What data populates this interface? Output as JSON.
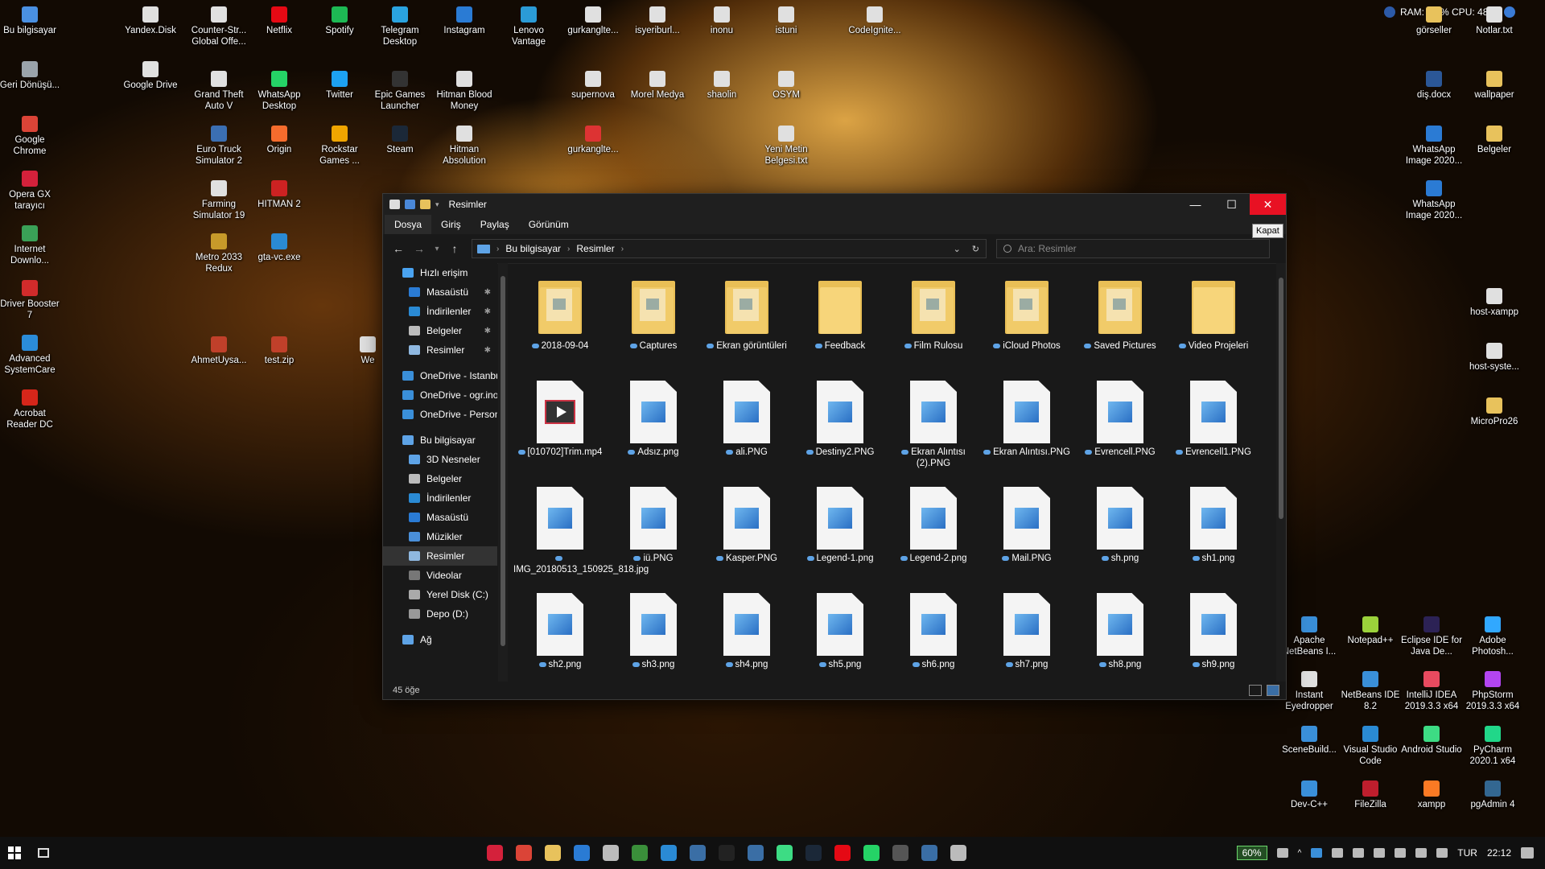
{
  "desktop": {
    "icons": [
      {
        "label": "Bu bilgisayar",
        "color": "#4a90e2"
      },
      {
        "label": "Geri Dönüşü...",
        "color": "#9aa3ab"
      },
      {
        "label": "Google Chrome",
        "color": "#db4437"
      },
      {
        "label": "Opera GX tarayıcı",
        "color": "#d4213b"
      },
      {
        "label": "Internet Downlo...",
        "color": "#3aa157"
      },
      {
        "label": "Driver Booster 7",
        "color": "#d12b2b"
      },
      {
        "label": "Advanced SystemCare",
        "color": "#2b8cd9"
      },
      {
        "label": "Acrobat Reader DC",
        "color": "#d6261a"
      },
      {
        "label": "Yandex.Disk",
        "color": "#e0e0e0"
      },
      {
        "label": "Google Drive",
        "color": "#e0e0e0"
      },
      {
        "label": "Counter-Str... Global Offe...",
        "color": "#e0e0e0"
      },
      {
        "label": "Grand Theft Auto V",
        "color": "#e0e0e0"
      },
      {
        "label": "Euro Truck Simulator 2",
        "color": "#3b6fb3"
      },
      {
        "label": "Farming Simulator 19",
        "color": "#e0e0e0"
      },
      {
        "label": "Metro 2033 Redux",
        "color": "#c79a2a"
      },
      {
        "label": "AhmetUysa...",
        "color": "#c0402a"
      },
      {
        "label": "Netflix",
        "color": "#e50914"
      },
      {
        "label": "WhatsApp Desktop",
        "color": "#25d366"
      },
      {
        "label": "Origin",
        "color": "#f56c2d"
      },
      {
        "label": "HITMAN 2",
        "color": "#c22"
      },
      {
        "label": "gta-vc.exe",
        "color": "#2a8ad4"
      },
      {
        "label": "test.zip",
        "color": "#c0402a"
      },
      {
        "label": "Spotify",
        "color": "#1db954"
      },
      {
        "label": "Twitter",
        "color": "#1da1f2"
      },
      {
        "label": "Rockstar Games ...",
        "color": "#f0a500"
      },
      {
        "label": "Telegram Desktop",
        "color": "#2aa3df"
      },
      {
        "label": "Epic Games Launcher",
        "color": "#333"
      },
      {
        "label": "Steam",
        "color": "#1b2838"
      },
      {
        "label": "Instagram",
        "color": "#2a7bd4"
      },
      {
        "label": "Hitman Blood Money",
        "color": "#e0e0e0"
      },
      {
        "label": "Hitman Absolution",
        "color": "#e0e0e0"
      },
      {
        "label": "Lenovo Vantage",
        "color": "#2b9bd6"
      },
      {
        "label": "gurkanglte...",
        "color": "#e0e0e0"
      },
      {
        "label": "supernova",
        "color": "#e0e0e0"
      },
      {
        "label": "gurkanglte...",
        "color": "#d33"
      },
      {
        "label": "isyeriburl...",
        "color": "#e0e0e0"
      },
      {
        "label": "Morel Medya",
        "color": "#e0e0e0"
      },
      {
        "label": "inonu",
        "color": "#e0e0e0"
      },
      {
        "label": "shaolin",
        "color": "#e0e0e0"
      },
      {
        "label": "istuni",
        "color": "#e0e0e0"
      },
      {
        "label": "OSYM",
        "color": "#e0e0e0"
      },
      {
        "label": "Yeni Metin Belgesi.txt",
        "color": "#e0e0e0"
      },
      {
        "label": "CodeIgnite...",
        "color": "#e0e0e0"
      },
      {
        "label": "görseller",
        "color": "#e8c25c"
      },
      {
        "label": "diş.docx",
        "color": "#2b5797"
      },
      {
        "label": "WhatsApp Image 2020...",
        "color": "#2b7bd4"
      },
      {
        "label": "WhatsApp Image 2020...",
        "color": "#2b7bd4"
      },
      {
        "label": "Notlar.txt",
        "color": "#e0e0e0"
      },
      {
        "label": "wallpaper",
        "color": "#e8c25c"
      },
      {
        "label": "Belgeler",
        "color": "#e8c25c"
      },
      {
        "label": "host-xampp",
        "color": "#e0e0e0"
      },
      {
        "label": "host-syste...",
        "color": "#e0e0e0"
      },
      {
        "label": "MicroPro26",
        "color": "#e8c25c"
      },
      {
        "label": "Apache NetBeans I...",
        "color": "#3a8fd9"
      },
      {
        "label": "Instant Eyedropper",
        "color": "#e0e0e0"
      },
      {
        "label": "SceneBuild...",
        "color": "#3a8fd9"
      },
      {
        "label": "Dev-C++",
        "color": "#3a8fd9"
      },
      {
        "label": "Notepad++",
        "color": "#9bd13b"
      },
      {
        "label": "NetBeans IDE 8.2",
        "color": "#3a8fd9"
      },
      {
        "label": "Visual Studio Code",
        "color": "#2a8ad4"
      },
      {
        "label": "FileZilla",
        "color": "#bf1e2d"
      },
      {
        "label": "Eclipse IDE for Java De...",
        "color": "#2c2255"
      },
      {
        "label": "IntelliJ IDEA 2019.3.3 x64",
        "color": "#e84a5f"
      },
      {
        "label": "Android Studio",
        "color": "#3ddc84"
      },
      {
        "label": "xampp",
        "color": "#fb7a24"
      },
      {
        "label": "Adobe Photosh...",
        "color": "#31a8ff"
      },
      {
        "label": "PhpStorm 2019.3.3 x64",
        "color": "#b345f1"
      },
      {
        "label": "PyCharm 2020.1 x64",
        "color": "#21d789"
      },
      {
        "label": "pgAdmin 4",
        "color": "#336791"
      },
      {
        "label": "We",
        "color": "#e0e0e0"
      }
    ]
  },
  "sysmon": {
    "text": "RAM: 78 %  CPU: 48 %"
  },
  "window": {
    "title": "Resimler",
    "close_tooltip": "Kapat",
    "ribbon_tabs": [
      "Dosya",
      "Giriş",
      "Paylaş",
      "Görünüm"
    ],
    "breadcrumb": [
      "Bu bilgisayar",
      "Resimler"
    ],
    "search_placeholder": "Ara: Resimler",
    "nav": [
      {
        "label": "Hızlı erişim",
        "color": "#4aa3f0",
        "pinned": false
      },
      {
        "label": "Masaüstü",
        "color": "#2a7bd4",
        "pinned": true
      },
      {
        "label": "İndirilenler",
        "color": "#2a8ad4",
        "pinned": true
      },
      {
        "label": "Belgeler",
        "color": "#bbb",
        "pinned": true
      },
      {
        "label": "Resimler",
        "color": "#8fb8e0",
        "pinned": true
      },
      {
        "label": "OneDrive - Istanbul",
        "color": "#3a8fd9",
        "pinned": false
      },
      {
        "label": "OneDrive - ogr.inonu",
        "color": "#3a8fd9",
        "pinned": false
      },
      {
        "label": "OneDrive - Personal",
        "color": "#3a8fd9",
        "pinned": false
      },
      {
        "label": "Bu bilgisayar",
        "color": "#5ea3e6",
        "pinned": false
      },
      {
        "label": "3D Nesneler",
        "color": "#5ea3e6",
        "pinned": false
      },
      {
        "label": "Belgeler",
        "color": "#bbb",
        "pinned": false
      },
      {
        "label": "İndirilenler",
        "color": "#2a8ad4",
        "pinned": false
      },
      {
        "label": "Masaüstü",
        "color": "#2a7bd4",
        "pinned": false
      },
      {
        "label": "Müzikler",
        "color": "#4a8fd9",
        "pinned": false
      },
      {
        "label": "Resimler",
        "color": "#8fb8e0",
        "pinned": false
      },
      {
        "label": "Videolar",
        "color": "#777",
        "pinned": false
      },
      {
        "label": "Yerel Disk (C:)",
        "color": "#aaa",
        "pinned": false
      },
      {
        "label": "Depo (D:)",
        "color": "#999",
        "pinned": false
      },
      {
        "label": "Ağ",
        "color": "#5ea3e6",
        "pinned": false
      }
    ],
    "files": [
      {
        "name": "2018-09-04",
        "type": "folder"
      },
      {
        "name": "Captures",
        "type": "folder"
      },
      {
        "name": "Ekran görüntüleri",
        "type": "folder"
      },
      {
        "name": "Feedback",
        "type": "folder-empty"
      },
      {
        "name": "Film Rulosu",
        "type": "folder"
      },
      {
        "name": "iCloud Photos",
        "type": "folder"
      },
      {
        "name": "Saved Pictures",
        "type": "folder"
      },
      {
        "name": "Video Projeleri",
        "type": "folder-empty"
      },
      {
        "name": "[010702]Trim.mp4",
        "type": "video"
      },
      {
        "name": "Adsız.png",
        "type": "image"
      },
      {
        "name": "ali.PNG",
        "type": "image"
      },
      {
        "name": "Destiny2.PNG",
        "type": "image"
      },
      {
        "name": "Ekran Alıntısı (2).PNG",
        "type": "image"
      },
      {
        "name": "Ekran Alıntısı.PNG",
        "type": "image"
      },
      {
        "name": "Evrencell.PNG",
        "type": "image"
      },
      {
        "name": "Evrencell1.PNG",
        "type": "image"
      },
      {
        "name": "IMG_20180513_150925_818.jpg",
        "type": "image"
      },
      {
        "name": "iü.PNG",
        "type": "image"
      },
      {
        "name": "Kasper.PNG",
        "type": "image"
      },
      {
        "name": "Legend-1.png",
        "type": "image"
      },
      {
        "name": "Legend-2.png",
        "type": "image"
      },
      {
        "name": "Mail.PNG",
        "type": "image"
      },
      {
        "name": "sh.png",
        "type": "image"
      },
      {
        "name": "sh1.png",
        "type": "image"
      },
      {
        "name": "sh2.png",
        "type": "image"
      },
      {
        "name": "sh3.png",
        "type": "image"
      },
      {
        "name": "sh4.png",
        "type": "image"
      },
      {
        "name": "sh5.png",
        "type": "image"
      },
      {
        "name": "sh6.png",
        "type": "image"
      },
      {
        "name": "sh7.png",
        "type": "image"
      },
      {
        "name": "sh8.png",
        "type": "image"
      },
      {
        "name": "sh9.png",
        "type": "image"
      }
    ],
    "status": "45 öğe"
  },
  "taskbar": {
    "apps": [
      {
        "name": "opera",
        "color": "#d4213b"
      },
      {
        "name": "chrome",
        "color": "#db4437"
      },
      {
        "name": "file-explorer",
        "color": "#e8c25c"
      },
      {
        "name": "mail",
        "color": "#2a7bd4"
      },
      {
        "name": "settings",
        "color": "#bbb"
      },
      {
        "name": "terminal",
        "color": "#3a8f3a"
      },
      {
        "name": "vscode",
        "color": "#2a8ad4"
      },
      {
        "name": "virtualbox",
        "color": "#3a6ea5"
      },
      {
        "name": "jetbrains",
        "color": "#222"
      },
      {
        "name": "steam",
        "color": "#3a6ea5"
      },
      {
        "name": "xbox",
        "color": "#3ddc84"
      },
      {
        "name": "steam-alt",
        "color": "#1b2838"
      },
      {
        "name": "netflix",
        "color": "#e50914"
      },
      {
        "name": "whatsapp",
        "color": "#25d366"
      },
      {
        "name": "calculator",
        "color": "#555"
      },
      {
        "name": "photos",
        "color": "#3a6ea5"
      },
      {
        "name": "notepad",
        "color": "#bbb"
      }
    ],
    "battery": "60%",
    "lang": "TUR",
    "time": "22:12"
  }
}
